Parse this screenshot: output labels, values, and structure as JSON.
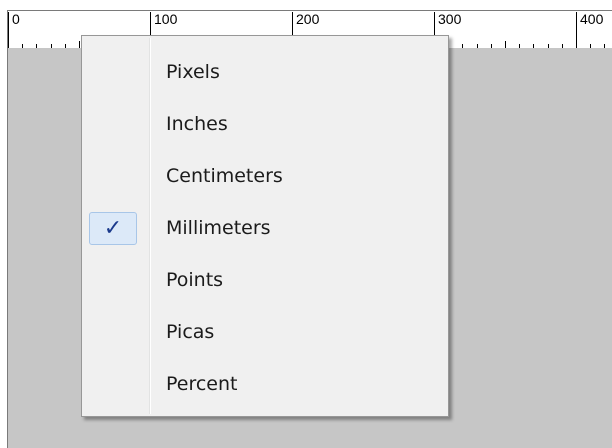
{
  "ruler": {
    "unit_labels": [
      "0",
      "100",
      "200",
      "300",
      "400"
    ]
  },
  "units_menu": {
    "items": [
      {
        "label": "Pixels",
        "checked": false
      },
      {
        "label": "Inches",
        "checked": false
      },
      {
        "label": "Centimeters",
        "checked": false
      },
      {
        "label": "Millimeters",
        "checked": true
      },
      {
        "label": "Points",
        "checked": false
      },
      {
        "label": "Picas",
        "checked": false
      },
      {
        "label": "Percent",
        "checked": false
      }
    ],
    "check_glyph": "✓"
  },
  "colors": {
    "canvas_background": "#c6c6c6",
    "menu_background": "#f0f0f0",
    "check_highlight": "#dce9f8",
    "check_color": "#1b3a8c"
  }
}
